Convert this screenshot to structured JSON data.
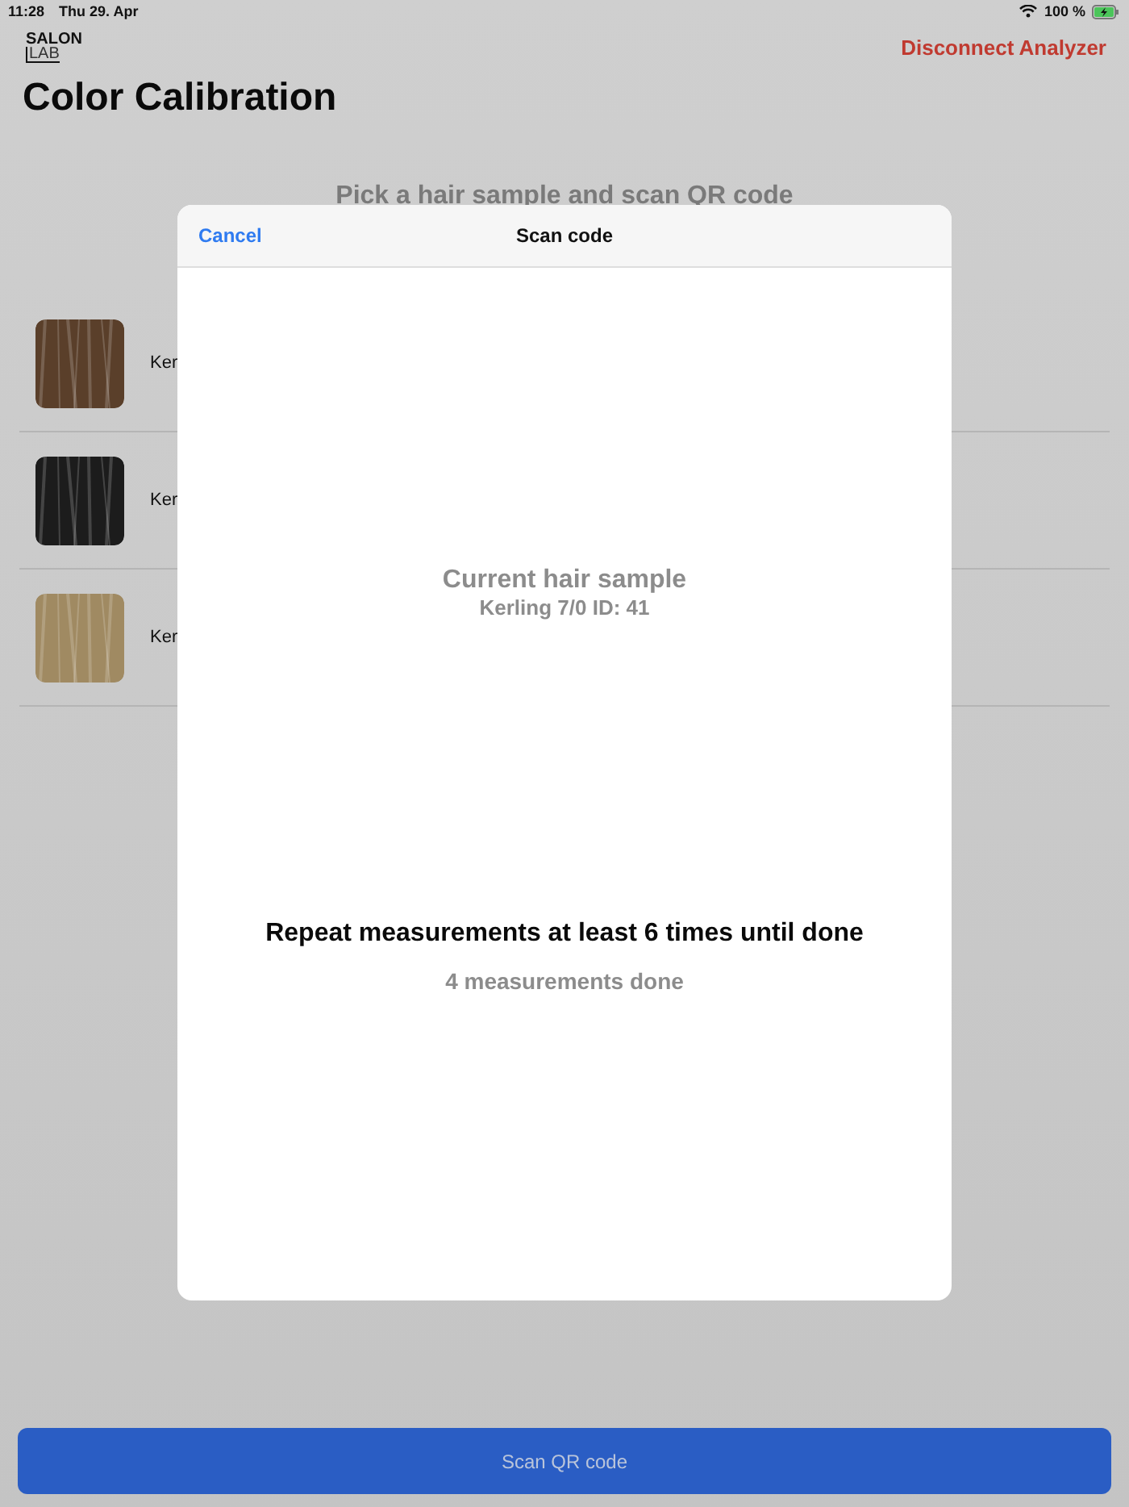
{
  "status_bar": {
    "time": "11:28",
    "date": "Thu 29. Apr",
    "battery": "100 %",
    "charging": true
  },
  "header": {
    "logo_top": "SALON",
    "logo_bottom": "LAB",
    "action": "Disconnect Analyzer",
    "title": "Color Calibration"
  },
  "subheading": "Pick a hair sample and scan QR code",
  "samples": [
    {
      "label": "Ker",
      "color": "#5a3f2a"
    },
    {
      "label": "Ker",
      "color": "#1c1c1c"
    },
    {
      "label": "Ker",
      "color": "#a08a62"
    }
  ],
  "modal": {
    "cancel": "Cancel",
    "title": "Scan code",
    "sample_heading": "Current hair sample",
    "sample_name": "Kerling 7/0 ID: 41",
    "instruction": "Repeat measurements at least 6 times until done",
    "progress": "4 measurements done"
  },
  "scan_button": "Scan QR code"
}
